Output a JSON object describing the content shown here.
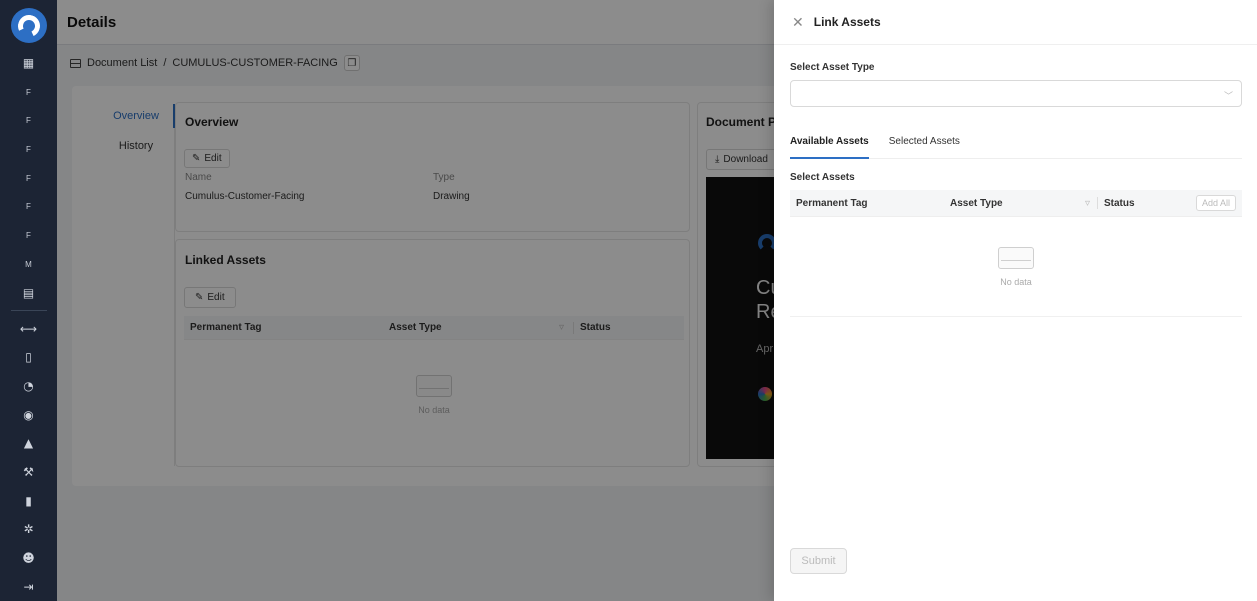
{
  "header": {
    "title": "Details"
  },
  "breadcrumb": {
    "root": "Document List",
    "separator": "/",
    "current": "CUMULUS-CUSTOMER-FACING"
  },
  "vertical_tabs": [
    {
      "label": "Overview",
      "active": true
    },
    {
      "label": "History",
      "active": false
    }
  ],
  "overview": {
    "title": "Overview",
    "edit_label": "Edit",
    "fields": [
      {
        "label": "Name",
        "value": "Cumulus-Customer-Facing"
      },
      {
        "label": "Type",
        "value": "Drawing"
      }
    ]
  },
  "linked_assets": {
    "title": "Linked Assets",
    "edit_label": "Edit",
    "columns": [
      "Permanent Tag",
      "Asset Type",
      "Status"
    ],
    "empty_text": "No data"
  },
  "document_preview": {
    "title": "Document Pr",
    "download_label": "Download",
    "preview_text": [
      "Cu",
      "Re",
      "Apr"
    ]
  },
  "sidebar": {
    "icons": [
      "grid-icon",
      "f-icon",
      "f-icon",
      "f-icon",
      "f-icon",
      "f-icon",
      "f-icon",
      "m-icon",
      "calendar-icon",
      "link-icon",
      "document-icon",
      "chart-icon",
      "eye-icon",
      "warning-icon",
      "wrench-icon",
      "clipboard-icon",
      "gear-icon",
      "users-icon",
      "logout-icon"
    ],
    "letters": [
      "F",
      "F",
      "F",
      "F",
      "F",
      "F",
      "M"
    ]
  },
  "drawer": {
    "title": "Link Assets",
    "select_asset_type_label": "Select Asset Type",
    "tabs": [
      {
        "label": "Available Assets",
        "active": true
      },
      {
        "label": "Selected Assets",
        "active": false
      }
    ],
    "select_assets_label": "Select Assets",
    "columns": [
      "Permanent Tag",
      "Asset Type",
      "Status"
    ],
    "add_all_label": "Add All",
    "empty_text": "No data",
    "submit_label": "Submit"
  },
  "colors": {
    "accent": "#2d6fc4",
    "sidebar": "#1c2434"
  }
}
